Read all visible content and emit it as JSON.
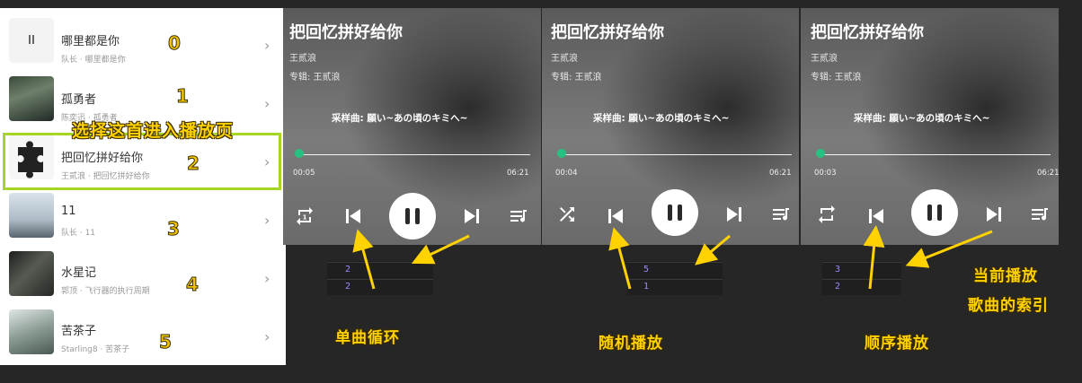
{
  "song_list": {
    "items": [
      {
        "title": "哪里都是你",
        "subtitle": "队长 · 哪里都是你",
        "index": "0"
      },
      {
        "title": "孤勇者",
        "subtitle": "陈奕迅 · 孤勇者",
        "index": "1"
      },
      {
        "title": "把回忆拼好给你",
        "subtitle": "王贰浪 · 把回忆拼好给你",
        "index": "2"
      },
      {
        "title": "11",
        "subtitle": "队长 · 11",
        "index": "3"
      },
      {
        "title": "水星记",
        "subtitle": "郭顶 · 飞行器的执行周期",
        "index": "4"
      },
      {
        "title": "苦茶子",
        "subtitle": "Starling8 · 苦茶子",
        "index": "5"
      }
    ],
    "selected_index": 2,
    "select_annotation": "选择这首进入播放页"
  },
  "players": [
    {
      "title": "把回忆拼好给你",
      "artist": "王贰浪",
      "album": "专辑: 王贰浪",
      "sample": "采样曲: 願い~あの頃のキミへ~",
      "current_time": "00:05",
      "total_time": "06:21",
      "progress": 0.013,
      "mode_icon": "repeat-one-icon",
      "index_values": [
        "2",
        "2"
      ],
      "caption": "单曲循环"
    },
    {
      "title": "把回忆拼好给你",
      "artist": "王贰浪",
      "album": "专辑: 王贰浪",
      "sample": "采样曲: 願い~あの頃のキミへ~",
      "current_time": "00:04",
      "total_time": "06:21",
      "progress": 0.01,
      "mode_icon": "shuffle-icon",
      "index_values": [
        "5",
        "1"
      ],
      "caption": "随机播放"
    },
    {
      "title": "把回忆拼好给你",
      "artist": "王贰浪",
      "album": "专辑: 王贰浪",
      "sample": "采样曲: 願い~あの頃のキミへ~",
      "current_time": "00:03",
      "total_time": "06:21",
      "progress": 0.008,
      "mode_icon": "repeat-icon",
      "index_values": [
        "3",
        "2"
      ],
      "caption": "顺序播放"
    }
  ],
  "index_annotation": {
    "line1": "当前播放",
    "line2": "歌曲的索引"
  },
  "colors": {
    "accent_green": "#26c281",
    "highlight_border": "#a6d623",
    "annotation_yellow": "#ffd200",
    "index_text": "#9b8cff"
  }
}
